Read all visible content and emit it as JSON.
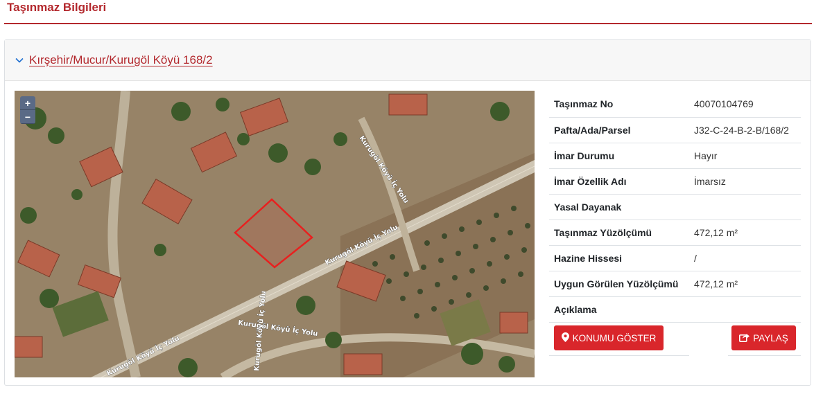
{
  "page": {
    "title": "Taşınmaz Bilgileri"
  },
  "card": {
    "header_link": "Kırşehir/Mucur/Kurugöl Köyü 168/2"
  },
  "map": {
    "zoom_in": "+",
    "zoom_out": "−",
    "road_labels": [
      "Kurugöl Köyü İç Yolu",
      "Kurugöl Köyü İç Yolu",
      "Kurugöl Köyü İç Yolu",
      "Kurugöl Köyü İç Yolu",
      "Kurugöl Köyü İç Yolu"
    ]
  },
  "info": {
    "rows": [
      {
        "key": "Taşınmaz No",
        "value": "40070104769"
      },
      {
        "key": "Pafta/Ada/Parsel",
        "value": "J32-C-24-B-2-B/168/2"
      },
      {
        "key": "İmar Durumu",
        "value": "Hayır"
      },
      {
        "key": "İmar Özellik Adı",
        "value": "İmarsız"
      },
      {
        "key": "Yasal Dayanak",
        "value": ""
      },
      {
        "key": "Taşınmaz Yüzölçümü",
        "value": "472,12 m²"
      },
      {
        "key": "Hazine Hissesi",
        "value": "/"
      },
      {
        "key": "Uygun Görülen Yüzölçümü",
        "value": "472,12 m²"
      },
      {
        "key": "Açıklama",
        "value": ""
      }
    ]
  },
  "buttons": {
    "locate_label": "KONUMU GÖSTER",
    "share_label": "PAYLAŞ"
  },
  "colors": {
    "brand": "#b3282d",
    "button": "#d9262b",
    "parcel_outline": "#e8201f"
  },
  "icons": {
    "chevron": "chevron-down-icon",
    "locate": "map-marker-icon",
    "share": "share-icon"
  }
}
